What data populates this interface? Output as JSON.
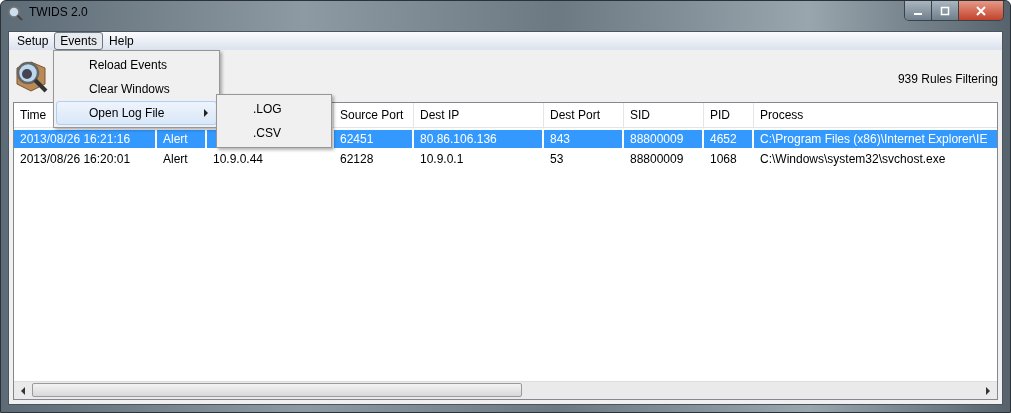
{
  "window": {
    "title": "TWIDS 2.0"
  },
  "menu_bar": [
    {
      "label": "Setup",
      "selected": false
    },
    {
      "label": "Events",
      "selected": true
    },
    {
      "label": "Help",
      "selected": false
    }
  ],
  "events_menu": [
    {
      "label": "Reload Events",
      "selected": false,
      "submenu": false
    },
    {
      "label": "Clear Windows",
      "selected": false,
      "submenu": false
    },
    {
      "label": "Open Log File",
      "selected": true,
      "submenu": true
    }
  ],
  "log_submenu": [
    {
      "label": ".LOG"
    },
    {
      "label": ".CSV"
    }
  ],
  "toolbar": {
    "status": "939 Rules Filtering"
  },
  "table": {
    "columns": [
      {
        "label": "Time"
      },
      {},
      {},
      {
        "label": "Source Port"
      },
      {
        "label": "Dest IP"
      },
      {
        "label": "Dest Port"
      },
      {
        "label": "SID"
      },
      {
        "label": "PID"
      },
      {
        "label": "Process"
      }
    ],
    "rows": [
      {
        "selected": true,
        "time": "2013/08/26 16:21:16",
        "action": "Alert",
        "source_port": "62451",
        "dest_ip": "80.86.106.136",
        "dest_port": "843",
        "sid": "88800009",
        "pid": "4652",
        "process": "C:\\Program Files (x86)\\Internet Explorer\\IE"
      },
      {
        "selected": false,
        "time": "2013/08/26 16:20:01",
        "action": "Alert",
        "source_ip": "10.9.0.44",
        "source_port": "62128",
        "dest_ip": "10.9.0.1",
        "dest_port": "53",
        "sid": "88800009",
        "pid": "1068",
        "process": "C:\\Windows\\system32\\svchost.exe"
      }
    ]
  }
}
